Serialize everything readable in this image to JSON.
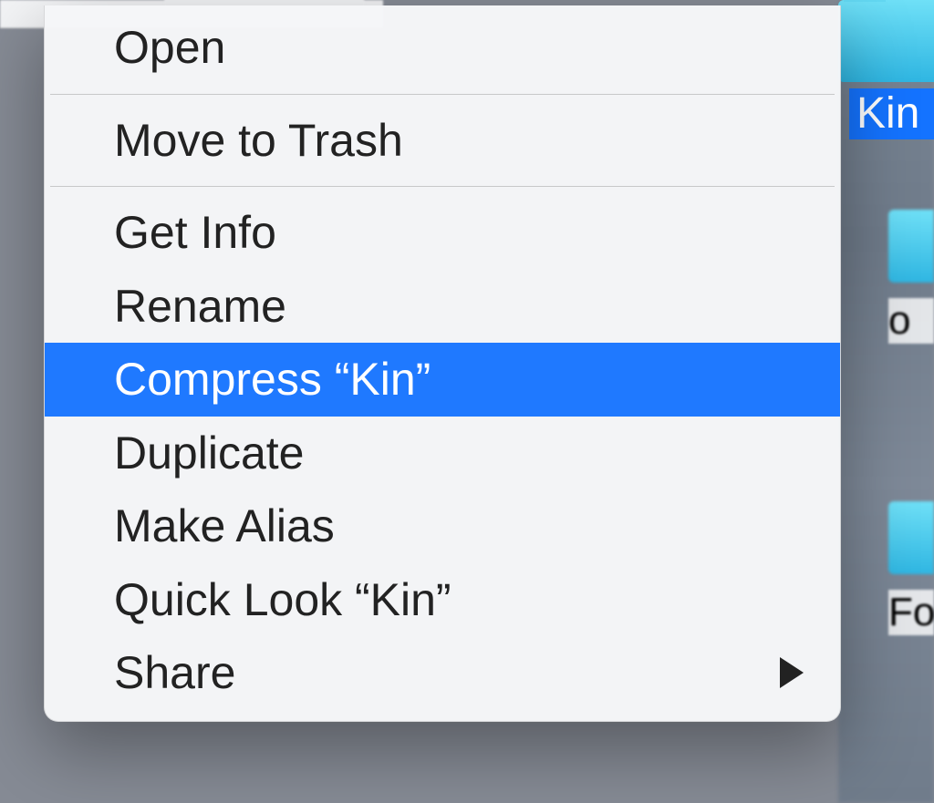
{
  "desktop": {
    "selected_file_label": "Kin",
    "bg_label_2": "o",
    "bg_label_3": "Fo"
  },
  "context_menu": {
    "open": "Open",
    "move_to_trash": "Move to Trash",
    "get_info": "Get Info",
    "rename": "Rename",
    "compress": "Compress “Kin”",
    "duplicate": "Duplicate",
    "make_alias": "Make Alias",
    "quick_look": "Quick Look “Kin”",
    "share": "Share",
    "highlighted": "compress"
  },
  "colors": {
    "highlight": "#1f79ff",
    "menu_bg": "#f5f6f8"
  }
}
